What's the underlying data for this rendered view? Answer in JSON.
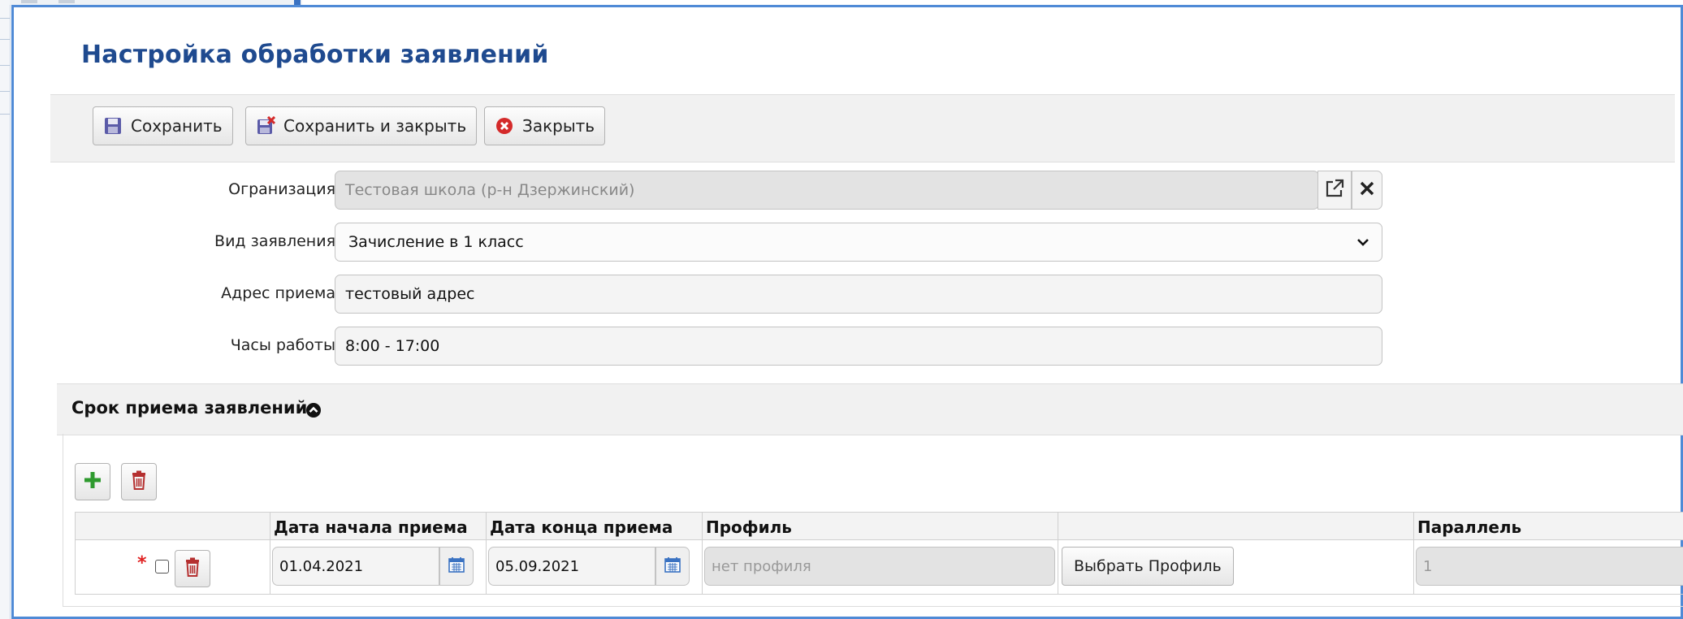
{
  "dialog": {
    "title": "Настройка обработки заявлений"
  },
  "toolbar": {
    "save_label": "Сохранить",
    "save_close_label": "Сохранить и закрыть",
    "close_label": "Закрыть"
  },
  "form": {
    "organization": {
      "label": "Огранизация",
      "value": "Тестовая школа (р-н Дзержинский)"
    },
    "application_type": {
      "label": "Вид заявления",
      "value": "Зачисление в 1 класс"
    },
    "address": {
      "label": "Адрес приема",
      "value": "тестовый адрес"
    },
    "hours": {
      "label": "Часы работы",
      "value": "8:00 - 17:00"
    }
  },
  "period_section": {
    "title": "Срок приема заявлений",
    "columns": [
      "",
      "Дата начала приема",
      "Дата конца приема",
      "Профиль",
      "",
      "Параллель"
    ],
    "rows": [
      {
        "required_mark": "*",
        "start_date": "01.04.2021",
        "end_date": "05.09.2021",
        "profile_placeholder": "нет профиля",
        "choose_profile_label": "Выбрать Профиль",
        "parallel_value": "1"
      }
    ]
  },
  "colors": {
    "title": "#1f4a8f",
    "border": "#4f8ad6",
    "required": "#e02020"
  },
  "icons": [
    "floppy-disk-icon",
    "save-close-icon",
    "close-circle-icon",
    "external-link-icon",
    "clear-x-icon",
    "chevron-down-icon",
    "chevron-up-circle-icon",
    "plus-icon",
    "trash-icon",
    "calendar-icon"
  ]
}
